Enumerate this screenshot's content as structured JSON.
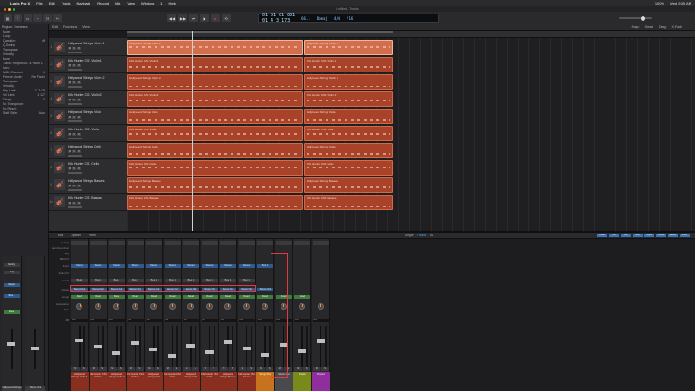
{
  "menubar": {
    "app": "Logic Pro X",
    "items": [
      "File",
      "Edit",
      "Track",
      "Navigate",
      "Record",
      "Mix",
      "View",
      "Window",
      "1",
      "Help"
    ],
    "right": [
      "100%",
      "Wed 9:35 AM"
    ]
  },
  "window": {
    "title": "Untitled - Tracks"
  },
  "control": {
    "lcd_bar": "01 01 01 001",
    "lcd_beat": "01 4 3 173",
    "lcd_tempo": "66.1",
    "lcd_key": "Dbmaj",
    "lcd_sig": "4/4",
    "lcd_div": "/16"
  },
  "inspector": {
    "header": "Region: Orchestra",
    "rows": [
      [
        "Mute:",
        ""
      ],
      [
        "Loop:",
        ""
      ],
      [
        "Quantize:",
        "off"
      ],
      [
        "Q-Swing:",
        ""
      ],
      [
        "Transpose:",
        ""
      ],
      [
        "Velocity:",
        ""
      ],
      [
        "More",
        ""
      ],
      [
        "Track: Hollywood...s Violin 1",
        ""
      ],
      [
        "Icon:",
        ""
      ],
      [
        "MIDI Channel:",
        "1"
      ],
      [
        "Freeze Mode:",
        "Pre Fader"
      ],
      [
        "Transpose:",
        ""
      ],
      [
        "Velocity:",
        ""
      ],
      [
        "Key Limit:",
        "C-2 G8"
      ],
      [
        "Vel Limit:",
        "1 127"
      ],
      [
        "Delay:",
        "0"
      ],
      [
        "No Transpose:",
        ""
      ],
      [
        "No Reset:",
        ""
      ],
      [
        "Staff Style:",
        "Auto"
      ]
    ]
  },
  "tracks_toolbar": [
    "Edit",
    "Functions",
    "View"
  ],
  "snap": {
    "label": "Snap:",
    "value": "Smart",
    "drag_label": "Drag:",
    "drag_value": "X-Fade"
  },
  "tracks": [
    {
      "num": "1",
      "name": "Hollywood Strings Violin 1"
    },
    {
      "num": "2",
      "name": "Kirk Hunter CS1 Violin 1"
    },
    {
      "num": "3",
      "name": "Hollywood Strings Violin 2"
    },
    {
      "num": "4",
      "name": "Kirk Hunter CS1 Violin 2"
    },
    {
      "num": "5",
      "name": "Hollywood Strings Viola"
    },
    {
      "num": "6",
      "name": "Kirk Hunter CS1 Viola"
    },
    {
      "num": "7",
      "name": "Hollywood Strings Cello"
    },
    {
      "num": "8",
      "name": "Kirk Hunter CS1 Cello"
    },
    {
      "num": "9",
      "name": "Hollywood Strings Basses"
    },
    {
      "num": "10",
      "name": "Kirk Hunter CS1 Basses"
    }
  ],
  "regions": [
    "Hollywood Strings Violin 1",
    "Kirk Hunter CS1 Violin 1",
    "Hollywood Strings Violin 2",
    "Kirk Hunter CS1 Violin 2",
    "Hollywood Strings Viola",
    "Kirk Hunter CS1 Viola",
    "Hollywood Strings Cello",
    "Kirk Hunter CS1 Cello",
    "Hollywood Strings Basses",
    "Kirk Hunter CS1 Basses"
  ],
  "mixer_toolbar": [
    "Edit",
    "Options",
    "View"
  ],
  "mixer_modes": [
    "Single",
    "Tracks",
    "All"
  ],
  "mixer_filters": [
    "Audio",
    "Inst",
    "Aux",
    "Bus",
    "Input",
    "Output",
    "Master",
    "MIDI"
  ],
  "mixer_row_labels": [
    "Setting",
    "Gain Reduction",
    "EQ",
    "MIDI FX",
    "Input",
    "Audio FX",
    "Sends",
    "Output",
    "Group",
    "Automation",
    "Pan",
    "dB"
  ],
  "strips": [
    {
      "name": "Hollywood Strings Violin 1",
      "input": "Stereo",
      "send": "Bus 1",
      "output": "Stereo Out",
      "group": "Read",
      "db": "0.0",
      "color": "red"
    },
    {
      "name": "Kirk Hunter CS1 Violin 1",
      "input": "Stereo",
      "send": "Bus 1",
      "output": "Stereo Out",
      "group": "Read",
      "db": "0.0",
      "color": "red"
    },
    {
      "name": "Hollywood Strings Violin 2",
      "input": "Stereo",
      "send": "Bus 1",
      "output": "Stereo Out",
      "group": "Read",
      "db": "0.0",
      "color": "red"
    },
    {
      "name": "Kirk Hunter CS1 Violin 2",
      "input": "Stereo",
      "send": "Bus 1",
      "output": "Stereo Out",
      "group": "Read",
      "db": "0.0",
      "color": "red"
    },
    {
      "name": "Hollywood Strings Viola",
      "input": "Stereo",
      "send": "Bus 1",
      "output": "Stereo Out",
      "group": "Read",
      "db": "0.0",
      "color": "red"
    },
    {
      "name": "Kirk Hunter CS1 Viola",
      "input": "Stereo",
      "send": "Bus 1",
      "output": "Stereo Out",
      "group": "Read",
      "db": "0.0",
      "color": "red"
    },
    {
      "name": "Hollywood Strings Cello",
      "input": "Stereo",
      "send": "Bus 1",
      "output": "Stereo Out",
      "group": "Read",
      "db": "0.0",
      "color": "red"
    },
    {
      "name": "Kirk Hunter CS1 Cello",
      "input": "Stereo",
      "send": "Bus 1",
      "output": "Stereo Out",
      "group": "Read",
      "db": "0.0",
      "color": "red"
    },
    {
      "name": "Hollywood Strings Basses",
      "input": "Stereo",
      "send": "Bus 1",
      "output": "Stereo Out",
      "group": "Read",
      "db": "0.0",
      "color": "red"
    },
    {
      "name": "Kirk Hunter CS1 Basses",
      "input": "Stereo",
      "send": "Bus 1",
      "output": "Stereo Out",
      "group": "Read",
      "db": "0.0",
      "color": "red"
    },
    {
      "name": "Strings Bus",
      "input": "Bus 1",
      "send": "",
      "output": "Stereo Out",
      "group": "Read",
      "db": "0.0",
      "color": "orange"
    },
    {
      "name": "Stereo Out",
      "input": "",
      "send": "",
      "output": "",
      "group": "Read",
      "db": "0.0",
      "color": "gray"
    },
    {
      "name": "Master",
      "input": "",
      "send": "",
      "output": "",
      "group": "Read",
      "db": "0.0",
      "color": "olive"
    },
    {
      "name": "Preview",
      "input": "",
      "send": "",
      "output": "",
      "group": "",
      "db": "0.0",
      "color": "purple"
    }
  ],
  "insp_strips": [
    {
      "label": "Hollywood Strings Violin 1"
    },
    {
      "label": "Stereo Out"
    }
  ],
  "insp_settings": {
    "label": "Setting",
    "eq": "EQ",
    "input": "Stereo",
    "output": "Bus 1",
    "group": "Read"
  }
}
